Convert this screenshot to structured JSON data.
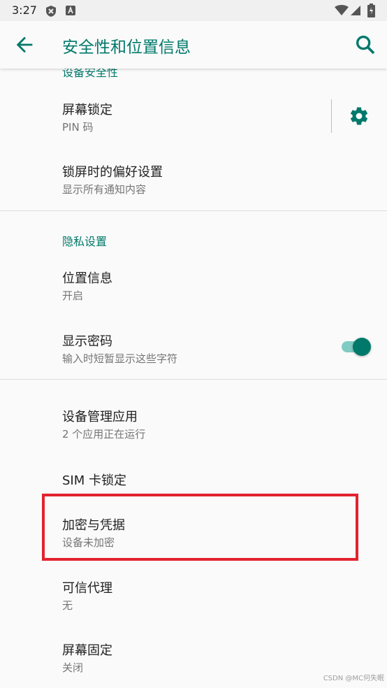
{
  "status_bar": {
    "time": "3:27"
  },
  "app_bar": {
    "title": "安全性和位置信息"
  },
  "sections": {
    "device_security_header": "设备安全性",
    "privacy_header": "隐私设置"
  },
  "items": {
    "screen_lock": {
      "title": "屏幕锁定",
      "subtitle": "PIN 码"
    },
    "lock_screen_prefs": {
      "title": "锁屏时的偏好设置",
      "subtitle": "显示所有通知内容"
    },
    "location": {
      "title": "位置信息",
      "subtitle": "开启"
    },
    "show_passwords": {
      "title": "显示密码",
      "subtitle": "输入时短暂显示这些字符",
      "enabled": true
    },
    "device_admin": {
      "title": "设备管理应用",
      "subtitle": "2 个应用正在运行"
    },
    "sim_lock": {
      "title": "SIM 卡锁定"
    },
    "encryption": {
      "title": "加密与凭据",
      "subtitle": "设备未加密"
    },
    "trust_agents": {
      "title": "可信代理",
      "subtitle": "无"
    },
    "screen_pinning": {
      "title": "屏幕固定",
      "subtitle": "关闭"
    }
  },
  "watermark": "CSDN @MC何失眠",
  "colors": {
    "accent": "#00796b",
    "highlight": "#e3222f",
    "toggle_track": "#80cbc4"
  },
  "icons": [
    "x-circle-icon",
    "a-box-icon",
    "wifi-icon",
    "signal-icon",
    "battery-icon",
    "back-arrow-icon",
    "search-icon",
    "gear-icon"
  ]
}
